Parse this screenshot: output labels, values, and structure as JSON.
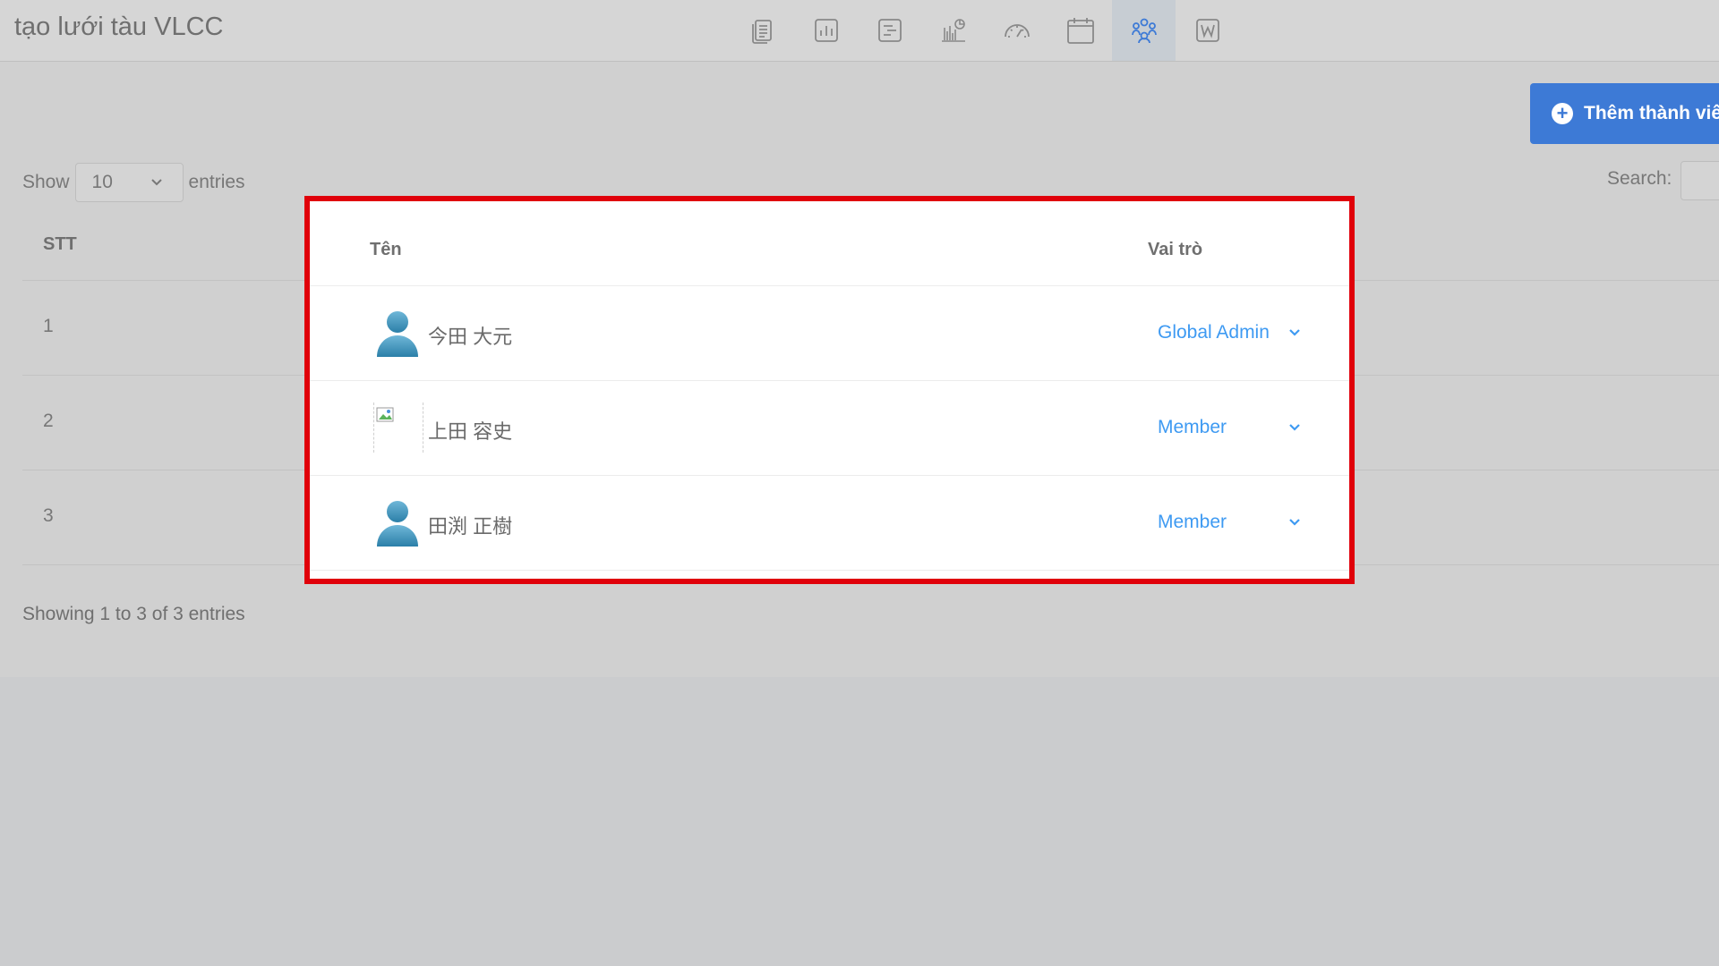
{
  "header": {
    "project_title": "tạo lưới tàu VLCC",
    "tools": [
      {
        "icon": "document-list-icon",
        "active": false
      },
      {
        "icon": "bar-chart-icon",
        "active": false
      },
      {
        "icon": "gantt-icon",
        "active": false
      },
      {
        "icon": "report-chart-icon",
        "active": false
      },
      {
        "icon": "dashboard-gauge-icon",
        "active": false
      },
      {
        "icon": "calendar-icon",
        "active": false
      },
      {
        "icon": "members-icon",
        "active": true
      },
      {
        "icon": "word-icon",
        "active": false
      }
    ]
  },
  "actions": {
    "add_member_label": "Thêm thành viê"
  },
  "table_controls": {
    "show_label": "Show",
    "page_length": "10",
    "entries_label": "entries",
    "search_label": "Search:"
  },
  "table": {
    "columns": {
      "stt": "STT",
      "name": "Tên",
      "role": "Vai trò"
    },
    "rows": [
      {
        "stt": "1",
        "name": "今田 大元",
        "role": "Global Admin",
        "avatar": "default-person-icon"
      },
      {
        "stt": "2",
        "name": "上田 容史",
        "role": "Member",
        "avatar": "broken-image-icon"
      },
      {
        "stt": "3",
        "name": "田渕 正樹",
        "role": "Member",
        "avatar": "default-person-icon"
      }
    ],
    "info": "Showing 1 to 3 of 3 entries"
  },
  "colors": {
    "accent": "#3d7ad6",
    "link": "#3e9af2",
    "highlight_border": "#e0000a"
  }
}
